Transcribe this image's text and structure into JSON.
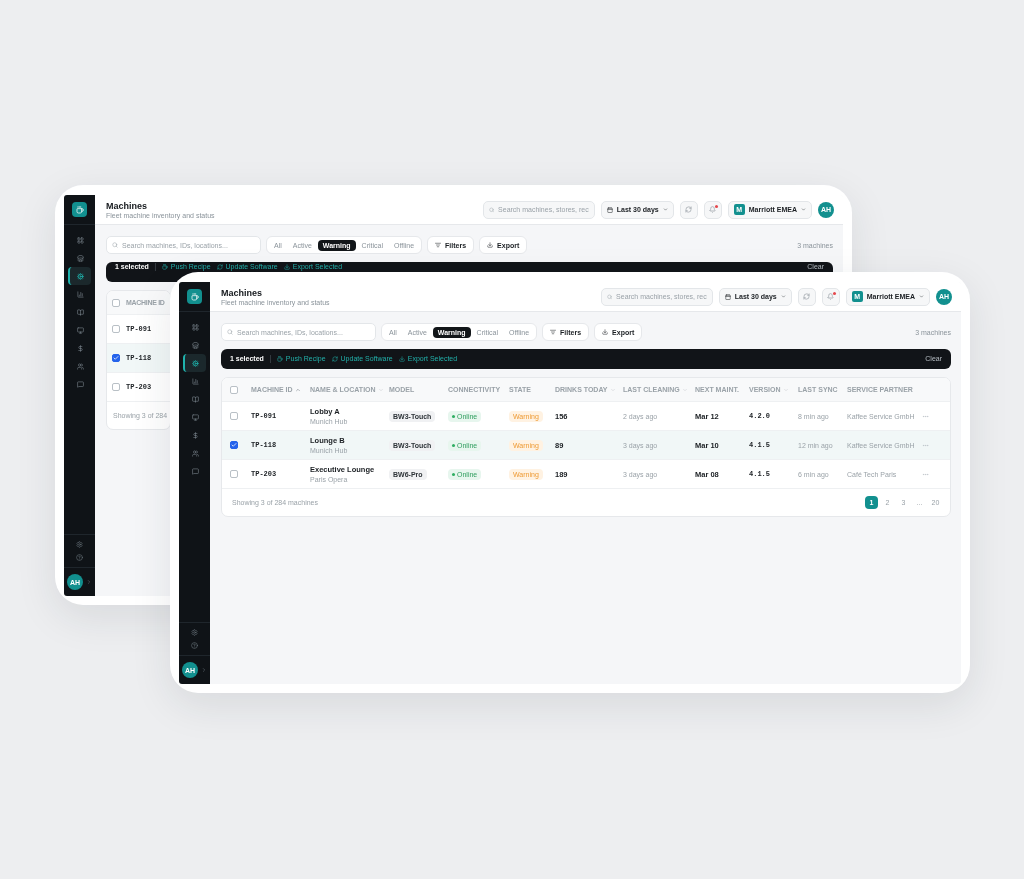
{
  "back_screen": {
    "header": {
      "title": "Machines",
      "subtitle": "Fleet machine inventory and status",
      "search_placeholder": "Search machines, stores, rec",
      "date_range": "Last 30 days",
      "notifications_unread": true,
      "org_initial": "M",
      "org_name": "Marriott EMEA",
      "avatar": "AH"
    },
    "sidebar": {
      "items": [
        {
          "kind": "dashboard",
          "selected": false
        },
        {
          "kind": "stores",
          "selected": false
        },
        {
          "kind": "machines",
          "selected": true
        },
        {
          "kind": "analytics",
          "selected": false
        },
        {
          "kind": "recipes",
          "selected": false
        },
        {
          "kind": "displays",
          "selected": false
        },
        {
          "kind": "billing",
          "selected": false
        },
        {
          "kind": "users",
          "selected": false
        },
        {
          "kind": "messages",
          "selected": false
        }
      ],
      "avatar": "AH"
    },
    "toolbar": {
      "search_placeholder": "Search machines, IDs, locations...",
      "tabs": [
        {
          "label": "All",
          "selected": false
        },
        {
          "label": "Active",
          "selected": false
        },
        {
          "label": "Warning",
          "selected": true
        },
        {
          "label": "Critical",
          "selected": false
        },
        {
          "label": "Offline",
          "selected": false
        }
      ],
      "filters": "Filters",
      "export": "Export",
      "count": "3 machines"
    },
    "bulk_bar": {
      "count": "1 selected",
      "actions": [
        {
          "kind": "recipe",
          "label": "Push Recipe"
        },
        {
          "kind": "update",
          "label": "Update Software"
        },
        {
          "kind": "export",
          "label": "Export Selected"
        }
      ],
      "clear": "Clear"
    },
    "table": {
      "all_selected": false,
      "columns": [
        {
          "kind": "id",
          "label": "MACHINE ID"
        }
      ],
      "rows": [
        {
          "id": "TP-091",
          "selected": false
        },
        {
          "id": "TP-118",
          "selected": true
        },
        {
          "id": "TP-203",
          "selected": false
        }
      ],
      "footer": "Showing 3 of 284"
    }
  },
  "front_screen": {
    "header": {
      "title": "Machines",
      "subtitle": "Fleet machine inventory and status",
      "search_placeholder": "Search machines, stores, rec",
      "date_range": "Last 30 days",
      "notifications_unread": true,
      "org_initial": "M",
      "org_name": "Marriott EMEA",
      "avatar": "AH"
    },
    "sidebar": {
      "items": [
        {
          "kind": "dashboard",
          "selected": false
        },
        {
          "kind": "stores",
          "selected": false
        },
        {
          "kind": "machines",
          "selected": true
        },
        {
          "kind": "analytics",
          "selected": false
        },
        {
          "kind": "recipes",
          "selected": false
        },
        {
          "kind": "displays",
          "selected": false
        },
        {
          "kind": "billing",
          "selected": false
        },
        {
          "kind": "users",
          "selected": false
        },
        {
          "kind": "messages",
          "selected": false
        }
      ],
      "avatar": "AH"
    },
    "toolbar": {
      "search_placeholder": "Search machines, IDs, locations...",
      "tabs": [
        {
          "label": "All",
          "selected": false
        },
        {
          "label": "Active",
          "selected": false
        },
        {
          "label": "Warning",
          "selected": true
        },
        {
          "label": "Critical",
          "selected": false
        },
        {
          "label": "Offline",
          "selected": false
        }
      ],
      "filters": "Filters",
      "export": "Export",
      "count": "3 machines"
    },
    "bulk_bar": {
      "count": "1 selected",
      "actions": [
        {
          "kind": "recipe",
          "label": "Push Recipe"
        },
        {
          "kind": "update",
          "label": "Update Software"
        },
        {
          "kind": "export",
          "label": "Export Selected"
        }
      ],
      "clear": "Clear"
    },
    "table": {
      "all_selected": false,
      "row_actions": true,
      "columns": [
        {
          "kind": "id",
          "label": "MACHINE ID",
          "sorted": true
        },
        {
          "kind": "name",
          "label": "NAME & LOCATION",
          "sorted": false
        },
        {
          "kind": "model",
          "label": "MODEL"
        },
        {
          "kind": "connectivity",
          "label": "CONNECTIVITY"
        },
        {
          "kind": "state",
          "label": "STATE"
        },
        {
          "kind": "drinks",
          "label": "DRINKS TODAY",
          "sorted": false
        },
        {
          "kind": "cleaning",
          "label": "LAST CLEANING",
          "sorted": false
        },
        {
          "kind": "maint",
          "label": "NEXT MAINT."
        },
        {
          "kind": "version",
          "label": "VERSION",
          "sorted": false
        },
        {
          "kind": "sync",
          "label": "LAST SYNC"
        },
        {
          "kind": "partner",
          "label": "SERVICE PARTNER"
        }
      ],
      "rows": [
        {
          "id": "TP-091",
          "selected": false,
          "name": "Lobby A",
          "location": "Munich Hub",
          "model": "BW3-Touch",
          "connectivity": {
            "label": "Online",
            "online": true
          },
          "state": {
            "label": "Warning",
            "warning": true
          },
          "drinks": "156",
          "last_cleaning": "2 days ago",
          "next_maint": "Mar 12",
          "version": "4.2.0",
          "last_sync": "8 min ago",
          "partner": "Kaffee Service GmbH"
        },
        {
          "id": "TP-118",
          "selected": true,
          "name": "Lounge B",
          "location": "Munich Hub",
          "model": "BW3-Touch",
          "connectivity": {
            "label": "Online",
            "online": true
          },
          "state": {
            "label": "Warning",
            "warning": true
          },
          "drinks": "89",
          "last_cleaning": "3 days ago",
          "next_maint": "Mar 10",
          "version": "4.1.5",
          "last_sync": "12 min ago",
          "partner": "Kaffee Service GmbH"
        },
        {
          "id": "TP-203",
          "selected": false,
          "name": "Executive Lounge",
          "location": "Paris Opera",
          "model": "BW6-Pro",
          "connectivity": {
            "label": "Online",
            "online": true
          },
          "state": {
            "label": "Warning",
            "warning": true
          },
          "drinks": "189",
          "last_cleaning": "3 days ago",
          "next_maint": "Mar 08",
          "version": "4.1.5",
          "last_sync": "6 min ago",
          "partner": "Café Tech Paris"
        }
      ],
      "footer": "Showing 3 of 284 machines",
      "pages": [
        {
          "label": "1",
          "selected": true
        },
        {
          "label": "2",
          "selected": false
        },
        {
          "label": "3",
          "selected": false
        },
        {
          "label": "...",
          "selected": false
        },
        {
          "label": "20",
          "selected": false
        }
      ]
    }
  }
}
